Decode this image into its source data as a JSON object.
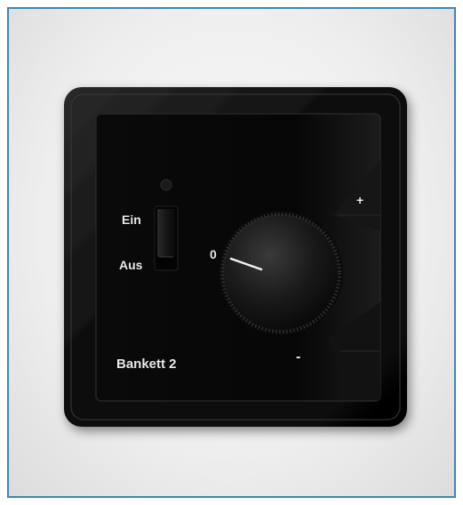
{
  "image": {
    "subject": "switch-thermostat-cover",
    "colors": {
      "outer_frame_border": "#3d86b8",
      "background": "#eeeeee",
      "device_frame": "#0b0b0b",
      "device_face": "#050505",
      "label_text": "#e8e8e8"
    }
  },
  "device": {
    "switch_labels": {
      "on": "Ein",
      "off": "Aus"
    },
    "dial_zero": "0",
    "plus_sign": "+",
    "minus_sign": "-",
    "name_label": "Bankett 2"
  }
}
